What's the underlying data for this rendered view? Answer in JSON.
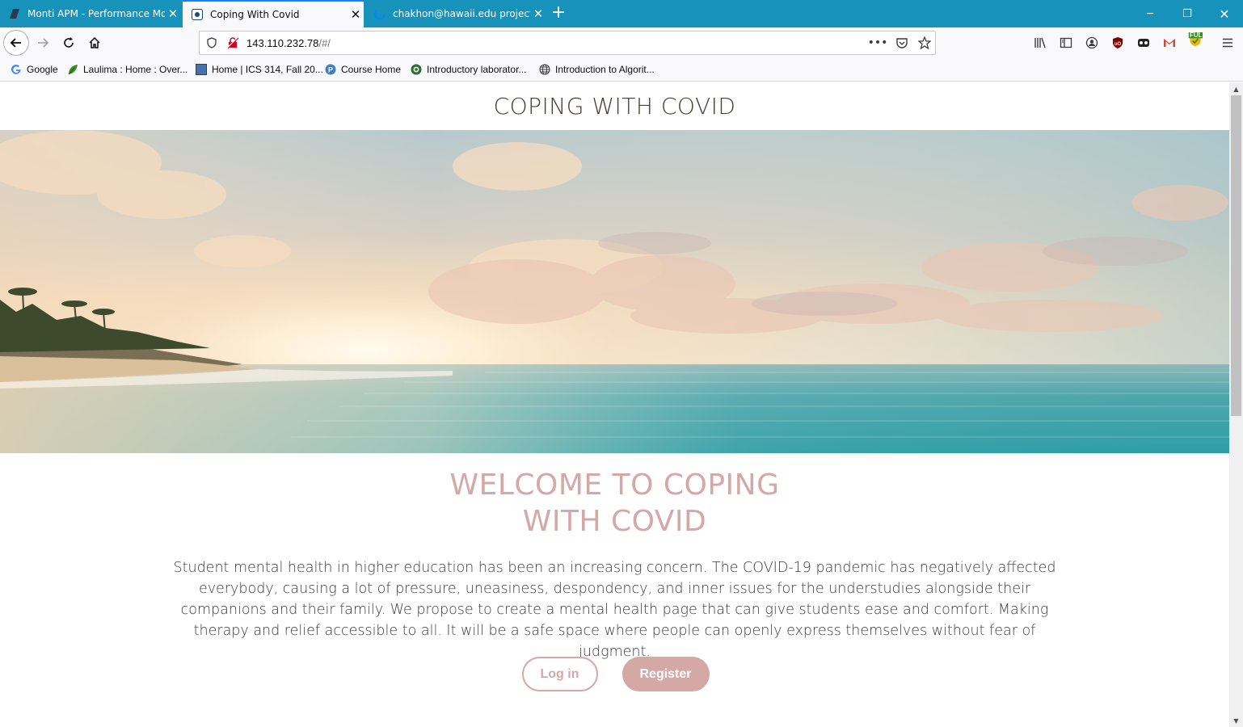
{
  "browser": {
    "tabs": [
      {
        "title": "Monti APM - Performance Mo",
        "active": false,
        "icon": "monti-icon"
      },
      {
        "title": "Coping With Covid",
        "active": true,
        "icon": "meteor-icon"
      },
      {
        "title": "chakhon@hawaii.edu project -",
        "active": false,
        "icon": "loading-icon"
      }
    ],
    "url": {
      "host": "143.110.232.78",
      "path": "/#/"
    },
    "bookmarks": [
      {
        "label": "Google",
        "icon": "google-icon"
      },
      {
        "label": "Laulima : Home : Over...",
        "icon": "leaf-icon"
      },
      {
        "label": "Home | ICS 314, Fall 20...",
        "icon": "square-icon"
      },
      {
        "label": "Course Home",
        "icon": "piazza-icon"
      },
      {
        "label": "Introductory laborator...",
        "icon": "seal-icon"
      },
      {
        "label": "Introduction to Algorit...",
        "icon": "globe-icon"
      }
    ],
    "extension_badge": "FULL",
    "accent": "#1692bb"
  },
  "page": {
    "site_title": "COPING WITH COVID",
    "welcome_line1": "WELCOME TO COPING",
    "welcome_line2": "WITH COVID",
    "description": "Student mental health in higher education has been an increasing concern. The COVID-19 pandemic has negatively affected everybody, causing a lot of pressure, uneasiness, despondency, and inner issues for the understudies alongside their companions and their family. We propose to create a mental health page that can give students ease and comfort. Making therapy and relief accessible to all. It will be a safe space where people can openly express themselves without fear of judgment.",
    "login_label": "Log in",
    "register_label": "Register",
    "accent_color": "#d4a8a4"
  }
}
